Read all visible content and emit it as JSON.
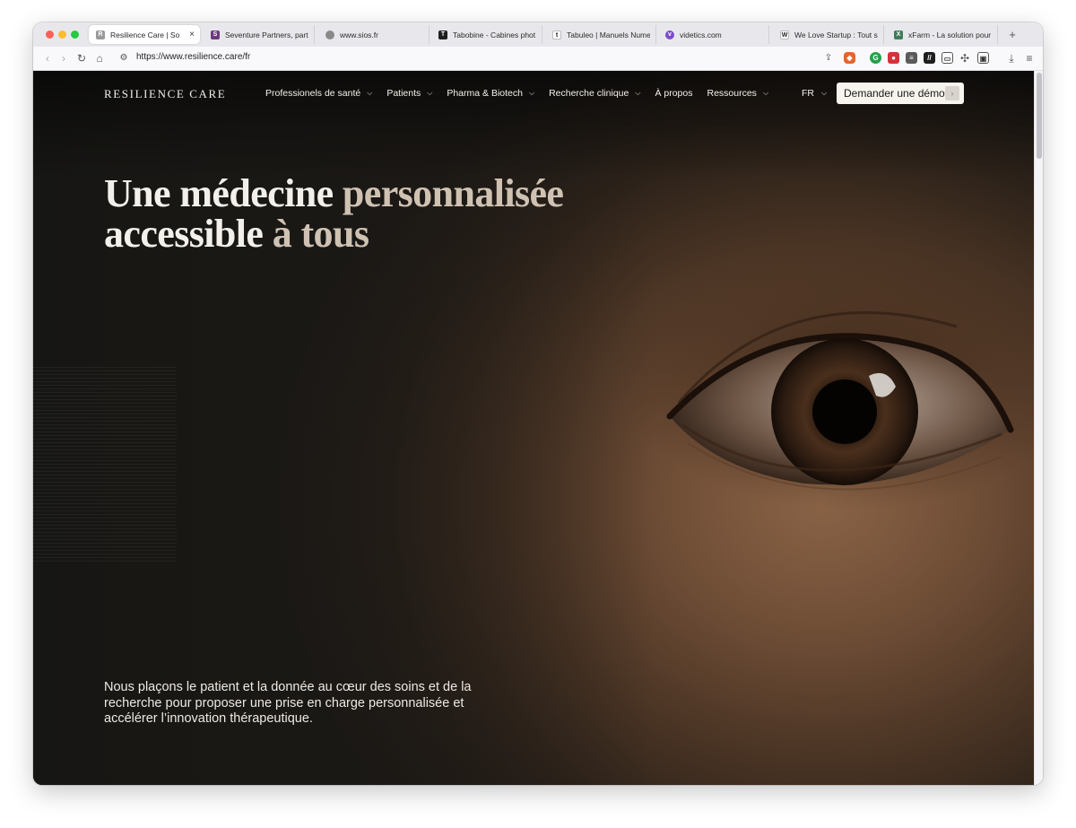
{
  "browser": {
    "tabs": [
      {
        "label": "Resilience Care | So",
        "favicon": "R",
        "color": "#7a7a7a",
        "active": true
      },
      {
        "label": "Seventure Partners, parte",
        "favicon": "S",
        "color": "#6b3a7d",
        "active": false
      },
      {
        "label": "www.sios.fr",
        "favicon": "globe",
        "color": "#8a8a8a",
        "active": false
      },
      {
        "label": "Tabobine - Cabines phot",
        "favicon": "T",
        "color": "#1e1e1e",
        "active": false
      },
      {
        "label": "Tabuleo | Manuels Nume",
        "favicon": "t",
        "color": "#ffffff",
        "active": false
      },
      {
        "label": "videtics.com",
        "favicon": "V",
        "color": "#7c4dcb",
        "active": false
      },
      {
        "label": "We Love Startup : Tout s",
        "favicon": "W",
        "color": "#ffffff",
        "active": false
      },
      {
        "label": "xFarm - La solution pour",
        "favicon": "X",
        "color": "#3f7c5a",
        "active": false
      }
    ],
    "new_tab_label": "+",
    "close_tab_label": "×",
    "url": "https://www.resilience.care/fr"
  },
  "site": {
    "logo": "RESILIENCE CARE",
    "menu": [
      {
        "label": "Professionels de santé",
        "has_dropdown": true
      },
      {
        "label": "Patients",
        "has_dropdown": true
      },
      {
        "label": "Pharma & Biotech",
        "has_dropdown": true
      },
      {
        "label": "Recherche clinique",
        "has_dropdown": true
      },
      {
        "label": "À propos",
        "has_dropdown": false
      },
      {
        "label": "Ressources",
        "has_dropdown": true
      }
    ],
    "language": "FR",
    "cta": "Demander une démo",
    "headline": {
      "line1_a": "Une médecine",
      "line1_b": "personnalisée",
      "line2_a": "accessible",
      "line2_b": "à tous"
    },
    "lede": "Nous plaçons le patient et la donnée au cœur des soins et de la recherche pour proposer une prise en charge personnalisée et accélérer l’innovation thérapeutique."
  },
  "colors": {
    "cta_bg": "#f7f4ee",
    "headline": "#f3f0eb",
    "headline_soft": "#cfc2b2",
    "hero_dark": "#1a1815",
    "hero_skin": "#8a6346"
  }
}
